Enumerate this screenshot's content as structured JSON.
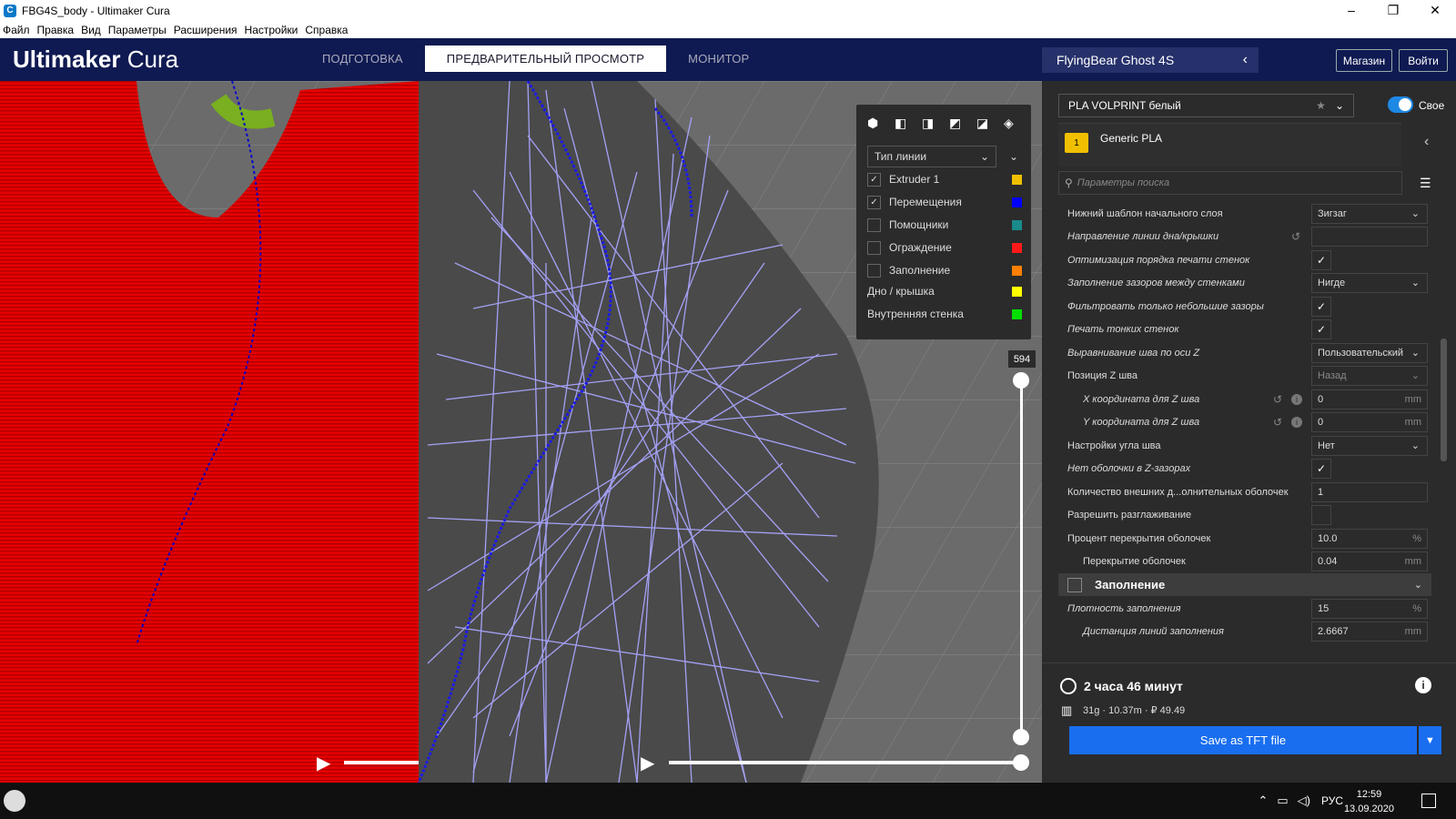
{
  "window": {
    "title": "FBG4S_body - Ultimaker Cura",
    "controls": [
      "–",
      "❐",
      "✕"
    ]
  },
  "menubar": [
    "Файл",
    "Правка",
    "Вид",
    "Параметры",
    "Расширения",
    "Настройки",
    "Справка"
  ],
  "header": {
    "logo_bold": "Ultimaker",
    "logo_light": " Cura",
    "stages": [
      {
        "label": "ПОДГОТОВКА",
        "active": false
      },
      {
        "label": "ПРЕДВАРИТЕЛЬНЫЙ ПРОСМОТР",
        "active": true
      },
      {
        "label": "МОНИТОР",
        "active": false
      }
    ],
    "printer": "FlyingBear Ghost 4S",
    "marketplace_label": "Магазин",
    "signin_label": "Войти"
  },
  "legend": {
    "view_icons": [
      "3d-view-icon",
      "front-view-icon",
      "top-view-icon",
      "left-view-icon",
      "right-view-icon",
      "xray-view-icon"
    ],
    "color_scheme": "Тип линии",
    "items": [
      {
        "label": "Extruder 1",
        "checkbox": true,
        "checked": true,
        "color": "#f0c000"
      },
      {
        "label": "Перемещения",
        "checkbox": true,
        "checked": true,
        "color": "#0000ff"
      },
      {
        "label": "Помощники",
        "checkbox": true,
        "checked": false,
        "color": "#1a8a8a"
      },
      {
        "label": "Ограждение",
        "checkbox": true,
        "checked": false,
        "color": "#ff1a1a"
      },
      {
        "label": "Заполнение",
        "checkbox": true,
        "checked": false,
        "color": "#ff7f00"
      },
      {
        "label": "Дно / крышка",
        "checkbox": false,
        "checked": false,
        "color": "#ffff00"
      },
      {
        "label": "Внутренняя стенка",
        "checkbox": false,
        "checked": false,
        "color": "#00e000"
      }
    ]
  },
  "layer_slider": {
    "current_layer": "594"
  },
  "sidebar": {
    "material": "PLA VOLPRINT белый",
    "custom_toggle_label": "Свое",
    "extruder_number": "1",
    "extruder_material": "Generic PLA",
    "search_placeholder": "Параметры поиска",
    "settings": [
      {
        "label": "Нижний шаблон начального слоя",
        "italic": false,
        "type": "select",
        "value": "Зигзаг"
      },
      {
        "label": "Направление линии дна/крышки",
        "italic": true,
        "type": "text",
        "value": "",
        "reset": true
      },
      {
        "label": "Оптимизация порядка печати стенок",
        "italic": true,
        "type": "checkbox",
        "value": "✓"
      },
      {
        "label": "Заполнение зазоров между стенками",
        "italic": true,
        "type": "select",
        "value": "Нигде"
      },
      {
        "label": "Фильтровать только небольшие зазоры",
        "italic": true,
        "type": "checkbox",
        "value": "✓"
      },
      {
        "label": "Печать тонких стенок",
        "italic": true,
        "type": "checkbox",
        "value": "✓"
      },
      {
        "label": "Выравнивание шва по оси Z",
        "italic": true,
        "type": "select",
        "value": "Пользовательский"
      },
      {
        "label": "Позиция Z шва",
        "italic": false,
        "type": "select",
        "value": "Назад"
      },
      {
        "label": "X координата для Z шва",
        "italic": true,
        "indent": true,
        "type": "number",
        "value": "0",
        "unit": "mm",
        "reset": true,
        "info": true
      },
      {
        "label": "Y координата для Z шва",
        "italic": true,
        "indent": true,
        "type": "number",
        "value": "0",
        "unit": "mm",
        "reset": true,
        "info": true
      },
      {
        "label": "Настройки угла шва",
        "italic": false,
        "type": "select",
        "value": "Нет"
      },
      {
        "label": "Нет оболочки в Z-зазорах",
        "italic": true,
        "type": "checkbox",
        "value": "✓"
      },
      {
        "label": "Количество внешних д...олнительных оболочек",
        "italic": false,
        "type": "number",
        "value": "1",
        "unit": ""
      },
      {
        "label": "Разрешить разглаживание",
        "italic": false,
        "type": "checkbox",
        "value": ""
      },
      {
        "label": "Процент перекрытия оболочек",
        "italic": false,
        "type": "number",
        "value": "10.0",
        "unit": "%"
      },
      {
        "label": "Перекрытие оболочек",
        "italic": false,
        "indent": true,
        "type": "number",
        "value": "0.04",
        "unit": "mm"
      }
    ],
    "section_title": "Заполнение",
    "after_section": [
      {
        "label": "Плотность заполнения",
        "italic": true,
        "type": "number",
        "value": "15",
        "unit": "%"
      },
      {
        "label": "Дистанция линий заполнения",
        "italic": true,
        "indent": true,
        "type": "number",
        "value": "2.6667",
        "unit": "mm"
      }
    ]
  },
  "print_info": {
    "time": "2 часа 46 минут",
    "usage": "31g · 10.37m · ₽ 49.49",
    "save_label": "Save as TFT file"
  },
  "taskbar": {
    "lang": "РУС",
    "time": "12:59",
    "date": "13.09.2020"
  }
}
